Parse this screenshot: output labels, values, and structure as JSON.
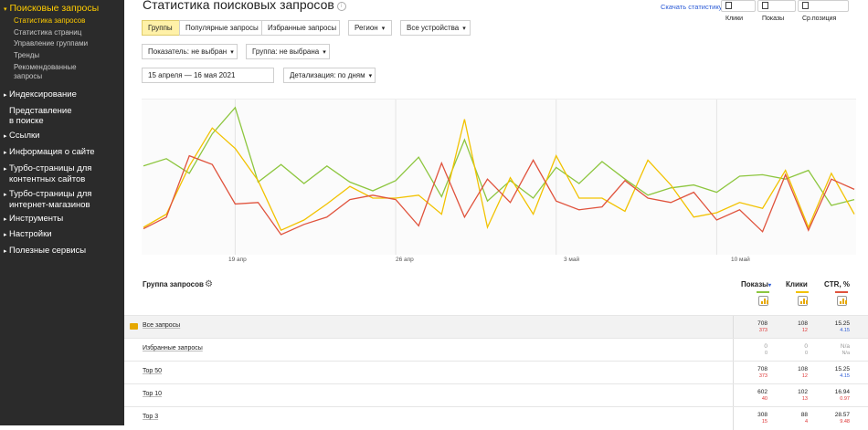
{
  "sidebar": {
    "top_item": "Поисковые запросы",
    "subitems": [
      "Статистика запросов",
      "Статистика страниц",
      "Управление группами",
      "Тренды",
      "Рекомендованные",
      "запросы"
    ],
    "sections": [
      {
        "label": "Индексирование"
      },
      {
        "label": "Представление",
        "label2": "в поиске"
      },
      {
        "label": "Ссылки"
      },
      {
        "label": "Информация о сайте"
      },
      {
        "label": "Турбо-страницы для",
        "label2": "контентных сайтов"
      },
      {
        "label": "Турбо-страницы для",
        "label2": "интернет-магазинов"
      },
      {
        "label": "Инструменты"
      },
      {
        "label": "Настройки"
      },
      {
        "label": "Полезные сервисы"
      }
    ]
  },
  "header": {
    "title": "Статистика поисковых запросов",
    "download_link": "Скачать статистику",
    "tabs": [
      "Клики",
      "Показы",
      "Ср.позиция"
    ]
  },
  "filters": {
    "groups": "Группы",
    "popular": "Популярные запросы",
    "favorites": "Избранные запросы",
    "region": "Регион",
    "devices": "Все устройства",
    "indicator": "Показатель: не выбран",
    "group": "Группа: не выбрана",
    "date_range": "15 апреля — 16 мая 2021",
    "detail": "Детализация: по дням"
  },
  "chart_data": {
    "type": "line",
    "x": [
      "15.04",
      "16.04",
      "17.04",
      "18.04",
      "19.04",
      "20.04",
      "21.04",
      "22.04",
      "23.04",
      "24.04",
      "25.04",
      "26.04",
      "27.04",
      "28.04",
      "29.04",
      "30.04",
      "01.05",
      "02.05",
      "03.05",
      "04.05",
      "05.05",
      "06.05",
      "07.05",
      "08.05",
      "09.05",
      "10.05",
      "11.05",
      "12.05",
      "13.05",
      "14.05",
      "15.05",
      "16.05"
    ],
    "x_tick_labels": [
      "19 апр",
      "26 апр",
      "3 май",
      "10 май"
    ],
    "series": [
      {
        "name": "Показы",
        "color": "#8dc63f",
        "values": [
          57,
          62,
          52,
          79,
          97,
          46,
          58,
          45,
          57,
          46,
          40,
          47,
          63,
          36,
          75,
          33,
          47,
          35,
          56,
          45,
          60,
          48,
          37,
          42,
          44,
          39,
          50,
          51,
          48,
          54,
          30,
          34
        ]
      },
      {
        "name": "Клики",
        "color": "#f2c200",
        "values": [
          15,
          24,
          57,
          83,
          69,
          47,
          13,
          20,
          31,
          43,
          35,
          35,
          37,
          24,
          89,
          15,
          49,
          24,
          64,
          35,
          35,
          26,
          61,
          44,
          22,
          25,
          32,
          28,
          54,
          15,
          52,
          24
        ]
      },
      {
        "name": "CTR",
        "color": "#e0533d",
        "values": [
          14,
          22,
          64,
          58,
          31,
          32,
          10,
          17,
          22,
          34,
          37,
          34,
          16,
          59,
          22,
          48,
          32,
          61,
          33,
          27,
          29,
          47,
          35,
          32,
          39,
          20,
          27,
          12,
          51,
          13,
          48,
          41
        ]
      }
    ]
  },
  "table": {
    "header": "Группа запросов",
    "columns": [
      "Показы",
      "Клики",
      "CTR, %"
    ],
    "rows": [
      {
        "name": "Все запросы",
        "shows": "708",
        "shows2": "373",
        "clicks": "108",
        "clicks2": "12",
        "ctr": "15.25",
        "ctr2": "4.15"
      },
      {
        "name": "Избранные запросы",
        "shows": "0",
        "shows2": "0",
        "clicks": "0",
        "clicks2": "0",
        "ctr": "N/a",
        "ctr2": "N/a"
      },
      {
        "name": "Top 50",
        "shows": "708",
        "shows2": "373",
        "clicks": "108",
        "clicks2": "12",
        "ctr": "15.25",
        "ctr2": "4.15"
      },
      {
        "name": "Top 10",
        "shows": "602",
        "shows2": "40",
        "clicks": "102",
        "clicks2": "13",
        "ctr": "16.94",
        "ctr2": "0.97"
      },
      {
        "name": "Top 3",
        "shows": "308",
        "shows2": "15",
        "clicks": "88",
        "clicks2": "4",
        "ctr": "28.57",
        "ctr2": "9.48"
      }
    ]
  }
}
